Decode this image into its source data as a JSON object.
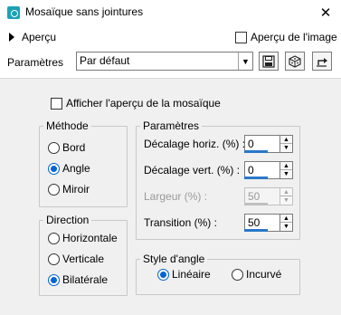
{
  "window": {
    "title": "Mosaïque sans jointures",
    "close": "✕"
  },
  "preview": {
    "label": "Aperçu",
    "image_preview_label": "Aperçu de l'image",
    "image_preview_checked": false
  },
  "presets": {
    "label": "Paramètres",
    "value": "Par défaut"
  },
  "options": {
    "show_preview_label": "Afficher l'aperçu de la mosaïque",
    "show_preview_checked": false
  },
  "method": {
    "title": "Méthode",
    "options": [
      "Bord",
      "Angle",
      "Miroir"
    ],
    "selected": "Angle"
  },
  "direction": {
    "title": "Direction",
    "options": [
      "Horizontale",
      "Verticale",
      "Bilatérale"
    ],
    "selected": "Bilatérale"
  },
  "parameters": {
    "title": "Paramètres",
    "h_offset_label": "Décalage horiz. (%) :",
    "h_offset_value": "0",
    "v_offset_label": "Décalage vert. (%) :",
    "v_offset_value": "0",
    "width_label": "Largeur (%) :",
    "width_value": "50",
    "transition_label": "Transition (%) :",
    "transition_value": "50"
  },
  "corner_style": {
    "title": "Style d'angle",
    "options": [
      "Linéaire",
      "Incurvé"
    ],
    "selected": "Linéaire"
  },
  "colors": {
    "accent": "#0064d2",
    "panel": "#f0f0f0",
    "app_icon": "#1aa3b5"
  }
}
